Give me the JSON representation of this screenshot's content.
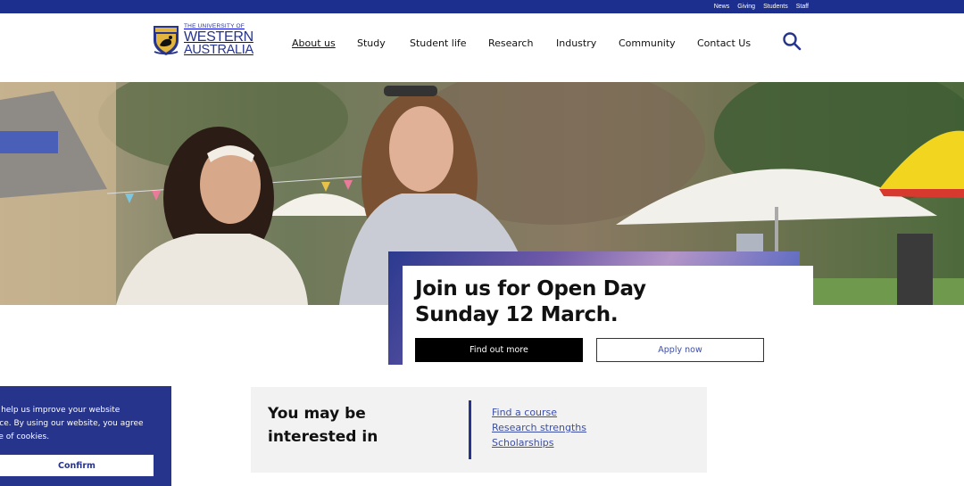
{
  "utility_nav": [
    "News",
    "Giving",
    "Students",
    "Staff"
  ],
  "logo": {
    "line1": "THE UNIVERSITY OF",
    "line2": "WESTERN",
    "line3": "AUSTRALIA"
  },
  "main_nav": [
    {
      "label": "About us",
      "active": true
    },
    {
      "label": "Study",
      "active": false
    },
    {
      "label": "Student life",
      "active": false
    },
    {
      "label": "Research",
      "active": false
    },
    {
      "label": "Industry",
      "active": false
    },
    {
      "label": "Community",
      "active": false
    },
    {
      "label": "Contact Us",
      "active": false
    }
  ],
  "search": {
    "icon": "search-icon"
  },
  "open_day": {
    "title_line1": "Join us for Open Day",
    "title_line2": "Sunday 12 March.",
    "primary_button": "Find out more",
    "secondary_button": "Apply now"
  },
  "interest": {
    "heading_line1": "You may be",
    "heading_line2": "interested in",
    "links": [
      "Find a course",
      "Research strengths",
      "Scholarships"
    ]
  },
  "cookie": {
    "text_line1": "es help us improve your website",
    "text_line2": "ence. By using our website, you agree",
    "text_line3": "use of cookies.",
    "confirm_button": "Confirm"
  },
  "colors": {
    "brand_blue": "#27348b",
    "topbar_blue": "#1c2f8f",
    "link_blue": "#3c4ea8"
  }
}
